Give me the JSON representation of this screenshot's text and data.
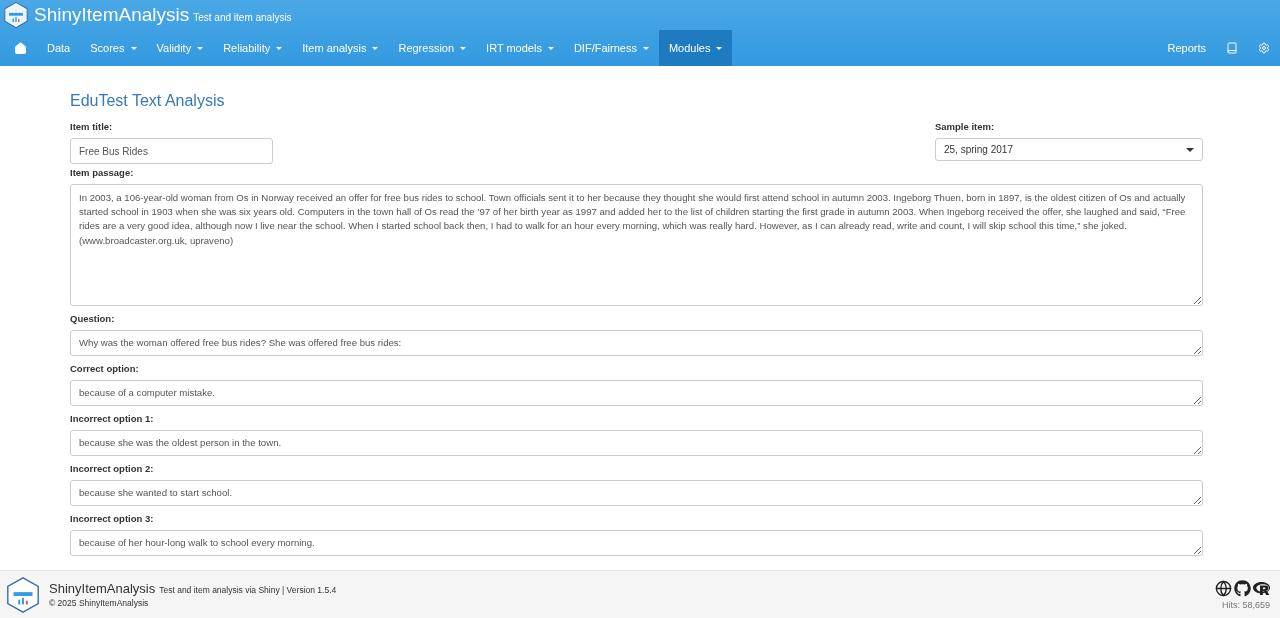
{
  "header": {
    "title": "ShinyItemAnalysis",
    "subtitle": "Test and item analysis"
  },
  "nav": {
    "items": [
      {
        "label": "Data",
        "dropdown": false,
        "selected": false
      },
      {
        "label": "Scores",
        "dropdown": true,
        "selected": false
      },
      {
        "label": "Validity",
        "dropdown": true,
        "selected": false
      },
      {
        "label": "Reliability",
        "dropdown": true,
        "selected": false
      },
      {
        "label": "Item analysis",
        "dropdown": true,
        "selected": false
      },
      {
        "label": "Regression",
        "dropdown": true,
        "selected": false
      },
      {
        "label": "IRT models",
        "dropdown": true,
        "selected": false
      },
      {
        "label": "DIF/Fairness",
        "dropdown": true,
        "selected": false
      },
      {
        "label": "Modules",
        "dropdown": true,
        "selected": true
      }
    ],
    "right_link": "Reports"
  },
  "page": {
    "title": "EduTest Text Analysis",
    "item_title": {
      "label": "Item title:",
      "value": "Free Bus Rides"
    },
    "sample_item": {
      "label": "Sample item:",
      "value": "25, spring 2017"
    },
    "fields": [
      {
        "label": "Item passage:",
        "kind": "tall",
        "value": "In 2003, a 106-year-old woman from Os in Norway received an offer for free bus rides to school. Town officials sent it to her because they thought she would first attend school in autumn 2003. Ingeborg Thuen, born in 1897, is the oldest citizen of Os and actually started school in 1903 when she was six years old. Computers in the town hall of Os read the ’97 of her birth year as 1997 and added her to the list of children starting the first grade in autumn 2003. When Ingeborg received the offer, she laughed and said, “Free rides are a very good idea, although now I live near the school. When I started school back then, I had to walk for an hour every morning, which was really hard. However, as I can already read, write and count, I will skip school this time,” she joked.\n(www.broadcaster.org.uk, upraveno)"
      },
      {
        "label": "Question:",
        "kind": "short",
        "value": "Why was the woman offered free bus rides? She was offered free bus rides:"
      },
      {
        "label": "Correct option:",
        "kind": "short",
        "value": "because of a computer mistake."
      },
      {
        "label": "Incorrect option 1:",
        "kind": "short",
        "value": "because she was the oldest person in the town."
      },
      {
        "label": "Incorrect option 2:",
        "kind": "short",
        "value": "because she wanted to start school."
      },
      {
        "label": "Incorrect option 3:",
        "kind": "short",
        "value": "because of her hour-long walk to school every morning."
      }
    ]
  },
  "footer": {
    "title": "ShinyItemAnalysis",
    "subtitle": "Test and item analysis via Shiny | Version 1.5.4",
    "copyright": "© 2025 ShinyItemAnalysis",
    "hits": "Hits: 58,659"
  }
}
